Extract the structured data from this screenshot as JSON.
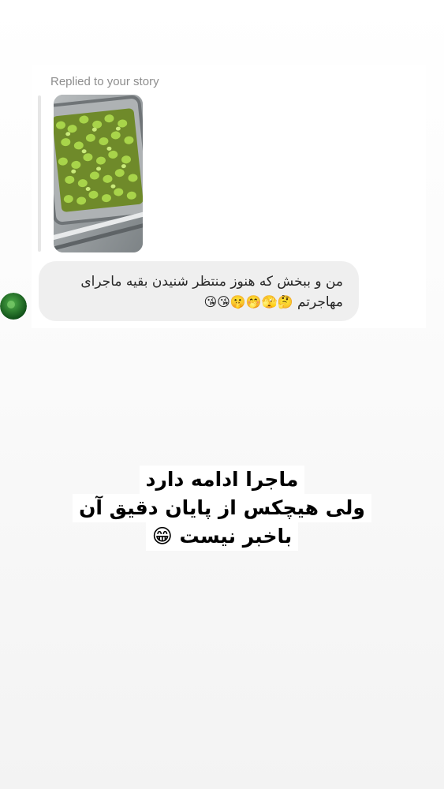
{
  "dm": {
    "replied_label": "Replied to your story",
    "message_text": "من و ببخش که هنوز منتظر شنیدن بقیه ماجرای مهاجرتم",
    "message_emojis": "🤔🫣🤭🤫😘😘"
  },
  "story_caption": {
    "lines": [
      "ماجرا ادامه دارد",
      "ولی هیچکس از پایان دقیق آن",
      "باخبر نیست 😁"
    ]
  },
  "colors": {
    "bubble_bg": "#efefef",
    "label_gray": "#8e8e8e",
    "text": "#262626"
  }
}
